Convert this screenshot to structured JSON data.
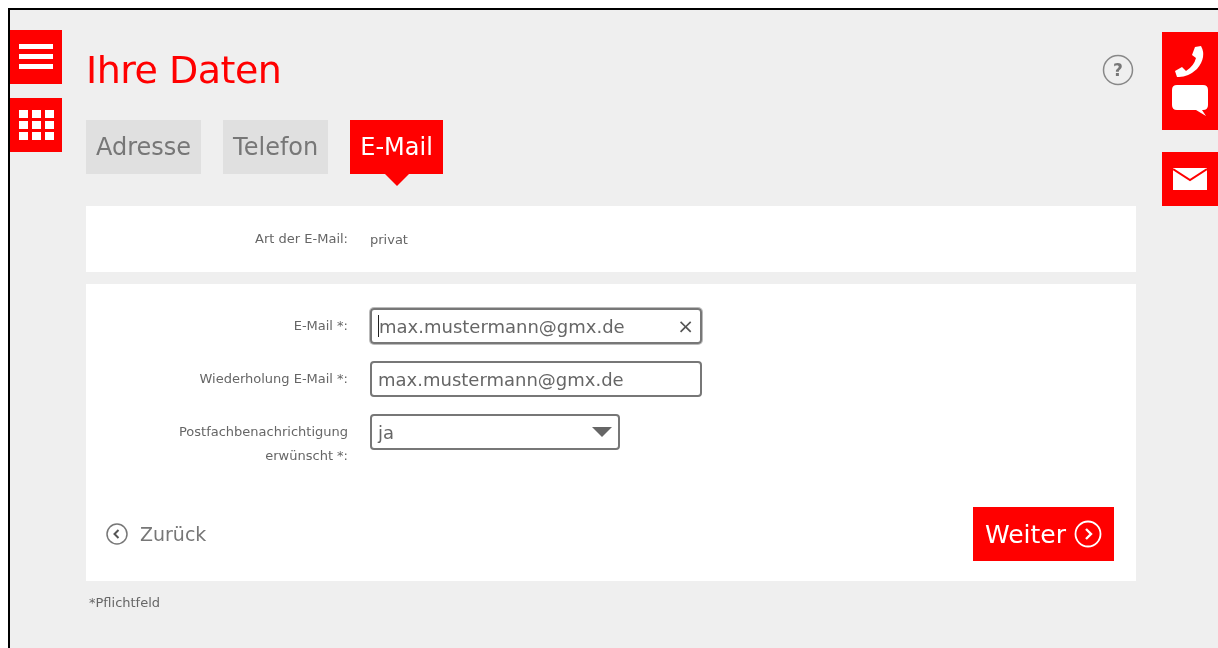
{
  "title": "Ihre Daten",
  "help": "?",
  "tabs": [
    {
      "label": "Adresse",
      "selected": false
    },
    {
      "label": "Telefon",
      "selected": false
    },
    {
      "label": "E-Mail",
      "selected": true
    }
  ],
  "info": {
    "label": "Art der E-Mail:",
    "value": "privat"
  },
  "fields": [
    {
      "kind": "text",
      "label": "E-Mail *:",
      "value": "max.mustermann@gmx.de",
      "focused": true,
      "clear": "×"
    },
    {
      "kind": "text",
      "label": "Wiederholung E-Mail *:",
      "value": "max.mustermann@gmx.de",
      "focused": false
    },
    {
      "kind": "select",
      "label": "Postfachbenachrichtigung erwünscht *:",
      "value": "ja"
    }
  ],
  "back": {
    "label": "Zurück"
  },
  "next": {
    "label": "Weiter"
  },
  "footnote": "*Pflichtfeld"
}
